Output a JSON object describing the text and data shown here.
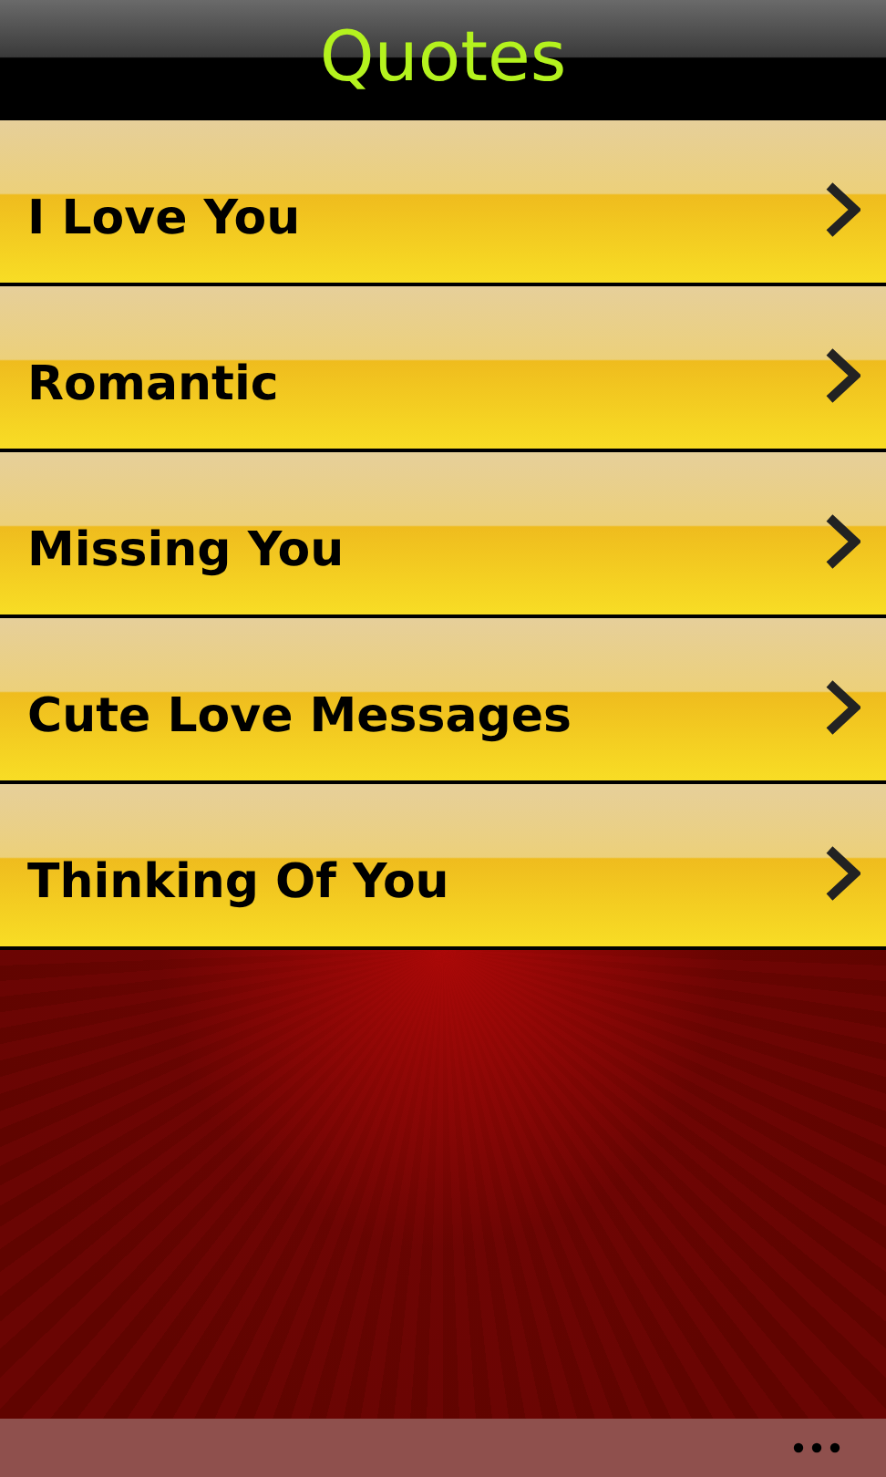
{
  "header": {
    "title": "Quotes"
  },
  "items": [
    {
      "label": "I Love You"
    },
    {
      "label": "Romantic"
    },
    {
      "label": "Missing You"
    },
    {
      "label": "Cute Love Messages"
    },
    {
      "label": "Thinking Of You"
    }
  ]
}
